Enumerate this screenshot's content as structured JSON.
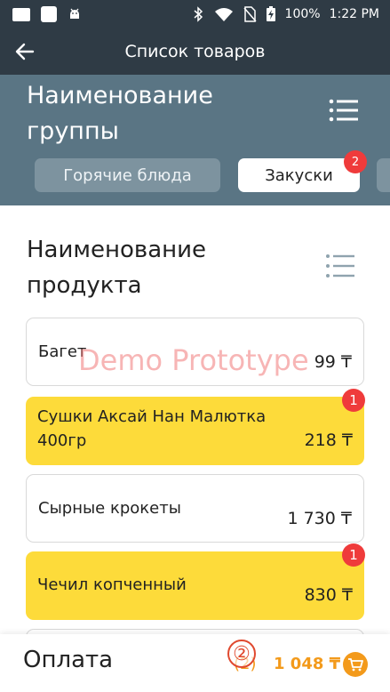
{
  "status_bar": {
    "battery": "100%",
    "time": "1:22 PM",
    "icons": [
      "message-icon",
      "image-icon",
      "android-icon",
      "bluetooth-icon",
      "wifi-icon",
      "no-sim-icon",
      "battery-icon"
    ]
  },
  "app_bar": {
    "title": "Список товаров",
    "back_icon": "arrow-left-icon"
  },
  "group": {
    "title": "Наименование группы",
    "menu_icon": "list-icon",
    "tabs": [
      {
        "label": "Горячие блюда",
        "active": false
      },
      {
        "label": "Закуски",
        "active": true,
        "badge": "2"
      }
    ]
  },
  "products": {
    "title": "Наименование продукта",
    "menu_icon": "list-icon",
    "items": [
      {
        "name": "Багет",
        "price": "99 ₸",
        "highlighted": false
      },
      {
        "name": "Сушки Аксай Нан Малютка 400гр",
        "price": "218 ₸",
        "highlighted": true,
        "badge": "1"
      },
      {
        "name": "Сырные крокеты",
        "price": "1 730 ₸",
        "highlighted": false
      },
      {
        "name": "Чечил копченный",
        "price": "830 ₸",
        "highlighted": true,
        "badge": "1"
      }
    ]
  },
  "watermark": "Demo Prototype",
  "bottom_bar": {
    "label": "Оплата",
    "count": "(2)",
    "total": "1 048 ₸",
    "cart_icon": "cart-icon"
  },
  "step_marker": "②",
  "colors": {
    "header_dark": "#2f3b45",
    "group_bg": "#5a7584",
    "highlight": "#fddb3a",
    "badge": "#ef3b3b",
    "accent": "#f39a1b"
  }
}
